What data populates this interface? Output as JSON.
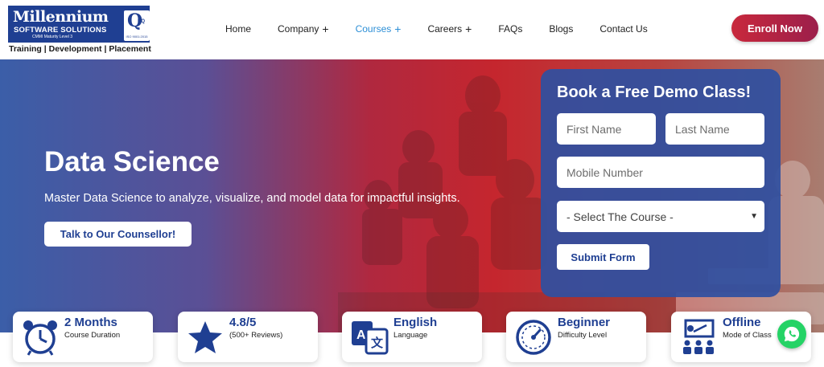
{
  "logo": {
    "title": "Millennium",
    "subtitle": "SOFTWARE SOLUTIONS",
    "cmmi": "CMMI Maturity Level 3",
    "iso": "ISO 9001:2015",
    "q_letter": "Q",
    "rq": "RQ",
    "tagline": "Training | Development | Placement"
  },
  "nav": {
    "items": [
      {
        "label": "Home",
        "plus": ""
      },
      {
        "label": "Company",
        "plus": "+"
      },
      {
        "label": "Courses",
        "plus": "+"
      },
      {
        "label": "Careers",
        "plus": "+"
      },
      {
        "label": "FAQs",
        "plus": ""
      },
      {
        "label": "Blogs",
        "plus": ""
      },
      {
        "label": "Contact Us",
        "plus": ""
      }
    ],
    "active_index": 2,
    "enroll_label": "Enroll Now"
  },
  "hero": {
    "title": "Data Science",
    "subtitle": "Master Data Science to analyze, visualize, and model data for impactful insights.",
    "counsellor_label": "Talk to Our Counsellor!"
  },
  "form": {
    "title": "Book a Free Demo Class!",
    "first_name_placeholder": "First Name",
    "last_name_placeholder": "Last Name",
    "mobile_placeholder": "Mobile Number",
    "course_selected": "- Select The Course -",
    "submit_label": "Submit Form"
  },
  "features": [
    {
      "icon": "clock-icon",
      "value": "2 Months",
      "label": "Course Duration"
    },
    {
      "icon": "star-icon",
      "value": "4.8/5",
      "label": "(500+ Reviews)"
    },
    {
      "icon": "translate-icon",
      "value": "English",
      "label": "Language"
    },
    {
      "icon": "gauge-icon",
      "value": "Beginner",
      "label": "Difficulty Level"
    },
    {
      "icon": "classroom-icon",
      "value": "Offline",
      "label": "Mode of Class"
    }
  ],
  "colors": {
    "brand_blue": "#1f3f92",
    "enroll_red": "#c8283c",
    "active_nav": "#2d8fd6",
    "whatsapp_green": "#25d366"
  }
}
